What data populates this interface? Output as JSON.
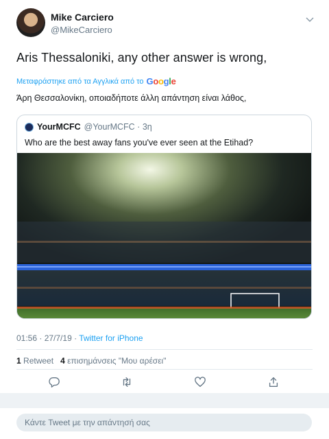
{
  "author": {
    "name": "Mike Carciero",
    "handle": "@MikeCarciero"
  },
  "tweet": {
    "text": "Aris Thessaloniki, any other answer is wrong,",
    "translation_label": "Μεταφράστηκε από τα Αγγλικά από το",
    "translation_provider": "Google",
    "translated_text": "Άρη Θεσσαλονίκη, οποιαδήποτε άλλη απάντηση είναι λάθος,"
  },
  "quoted": {
    "name": "YourMCFC",
    "handle_time": "@YourMCFC · 3η",
    "text": "Who are the best away fans you've ever seen at the Etihad?"
  },
  "meta": {
    "time": "01:56",
    "separator1": " · ",
    "date": "27/7/19",
    "separator2": " · ",
    "source": "Twitter for iPhone"
  },
  "stats": {
    "retweets_count": "1",
    "retweets_label": "Retweet",
    "likes_count": "4",
    "likes_label": "επισημάνσεις \"Μου αρέσει\""
  },
  "actions": [
    "reply-icon",
    "retweet-icon",
    "like-icon",
    "share-icon"
  ],
  "reply": {
    "placeholder": "Κάντε Tweet με την απάντησή σας"
  },
  "colors": {
    "link": "#1da1f2",
    "secondary_text": "#657786",
    "border": "#ccd6dd"
  }
}
